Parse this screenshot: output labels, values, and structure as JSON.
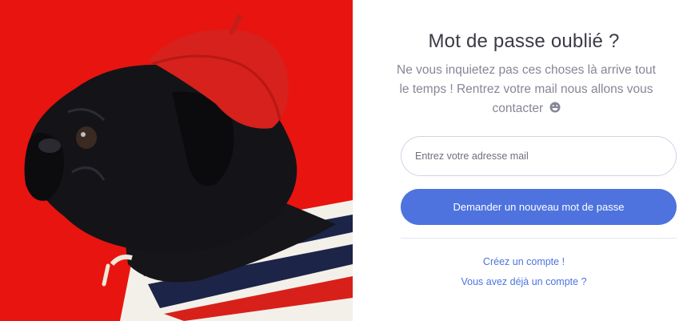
{
  "image": {
    "description_icon": "pug-photo",
    "background_color": "#e8140f"
  },
  "form": {
    "title": "Mot de passe oublié ?",
    "subtitle": "Ne vous inquietez pas ces choses là arrive tout le temps ! Rentrez votre mail nous allons vous contacter",
    "subtitle_icon": "grinning-face-icon",
    "email_placeholder": "Entrez votre adresse mail",
    "email_value": "",
    "submit_label": "Demander un nouveau mot de passe",
    "accent_color": "#4e73df"
  },
  "links": {
    "create_account": "Créez un compte !",
    "login": "Vous avez déjà un compte ?"
  }
}
